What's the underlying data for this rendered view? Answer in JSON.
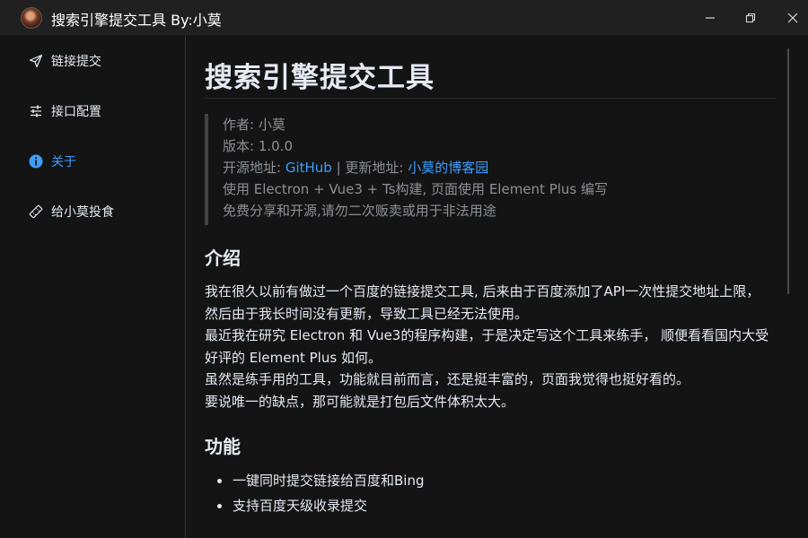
{
  "window": {
    "title": "搜索引擎提交工具 By:小莫"
  },
  "sidebar": {
    "items": [
      {
        "label": "链接提交",
        "icon": "send-icon",
        "active": false
      },
      {
        "label": "接口配置",
        "icon": "sliders-icon",
        "active": false
      },
      {
        "label": "关于",
        "icon": "info-icon",
        "active": true
      },
      {
        "label": "给小莫投食",
        "icon": "ticket-icon",
        "active": false
      }
    ]
  },
  "about": {
    "title": "搜索引擎提交工具",
    "author": "作者: 小莫",
    "version": "版本: 1.0.0",
    "opensource_label": "开源地址: ",
    "github_link": "GitHub",
    "separator": " | ",
    "update_label": "更新地址: ",
    "blog_link": "小莫的博客园",
    "tech": "使用 Electron + Vue3 + Ts构建, 页面使用 Element Plus 编写",
    "notice": "免费分享和开源,请勿二次贩卖或用于非法用途",
    "intro_title": "介绍",
    "intro_paragraphs": [
      "我在很久以前有做过一个百度的链接提交工具, 后来由于百度添加了API一次性提交地址上限，然后由于我长时间没有更新，导致工具已经无法使用。",
      "最近我在研究 Electron 和 Vue3的程序构建，于是决定写这个工具来练手， 顺便看看国内大受好评的 Element Plus 如何。",
      "虽然是练手用的工具，功能就目前而言，还是挺丰富的，页面我觉得也挺好看的。",
      "要说唯一的缺点，那可能就是打包后文件体积太大。"
    ],
    "features_title": "功能",
    "features": [
      "一键同时提交链接给百度和Bing",
      "支持百度天级收录提交"
    ]
  },
  "colors": {
    "accent": "#409eff",
    "background": "#141414",
    "titlebar": "#202020"
  }
}
